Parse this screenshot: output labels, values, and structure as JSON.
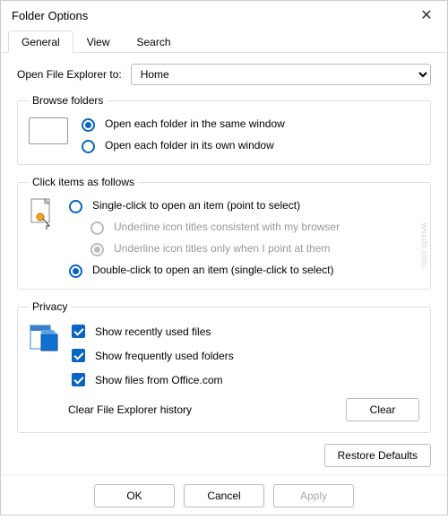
{
  "window": {
    "title": "Folder Options"
  },
  "tabs": {
    "general": "General",
    "view": "View",
    "search": "Search"
  },
  "open_explorer": {
    "label": "Open File Explorer to:",
    "value": "Home"
  },
  "browse": {
    "legend": "Browse folders",
    "same_window": "Open each folder in the same window",
    "own_window": "Open each folder in its own window"
  },
  "click": {
    "legend": "Click items as follows",
    "single": "Single-click to open an item (point to select)",
    "underline_browser": "Underline icon titles consistent with my browser",
    "underline_point": "Underline icon titles only when I point at them",
    "double": "Double-click to open an item (single-click to select)"
  },
  "privacy": {
    "legend": "Privacy",
    "recent_files": "Show recently used files",
    "frequent_folders": "Show frequently used folders",
    "office": "Show files from Office.com",
    "clear_label": "Clear File Explorer history",
    "clear_button": "Clear"
  },
  "restore": "Restore Defaults",
  "footer": {
    "ok": "OK",
    "cancel": "Cancel",
    "apply": "Apply"
  },
  "watermark": "wsxdn.com"
}
